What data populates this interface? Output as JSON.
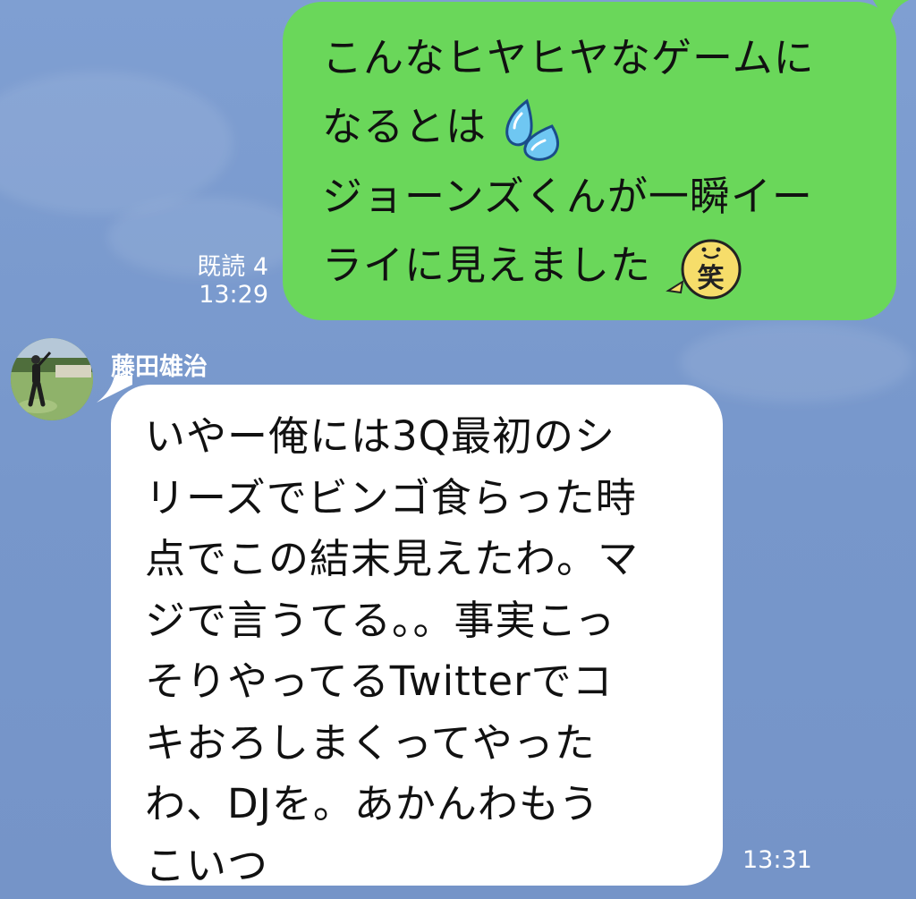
{
  "outgoing": {
    "lines": [
      "こんなヒヤヒヤなゲームに",
      "なるとは",
      "ジョーンズくんが一瞬イー",
      "ライに見えました"
    ],
    "read_status": "既読 4",
    "time": "13:29",
    "bubble_color": "#6ad75a"
  },
  "incoming": {
    "sender_name": "藤田雄治",
    "lines": [
      "いやー俺には3Q最初のシ",
      "リーズでビンゴ食らった時",
      "点でこの結末見えたわ。マ",
      "ジで言うてる。。事実こっ",
      "そりやってるTwitterでコ",
      "キおろしまくってやった",
      "わ、DJを。あかんわもう",
      "こいつ"
    ],
    "time": "13:31",
    "bubble_color": "#ffffff"
  },
  "emojis": {
    "sweat": "sweat-drops-icon",
    "laugh": "laugh-face-icon",
    "laugh_char": "笑"
  },
  "background_color": "#7b9bcf"
}
